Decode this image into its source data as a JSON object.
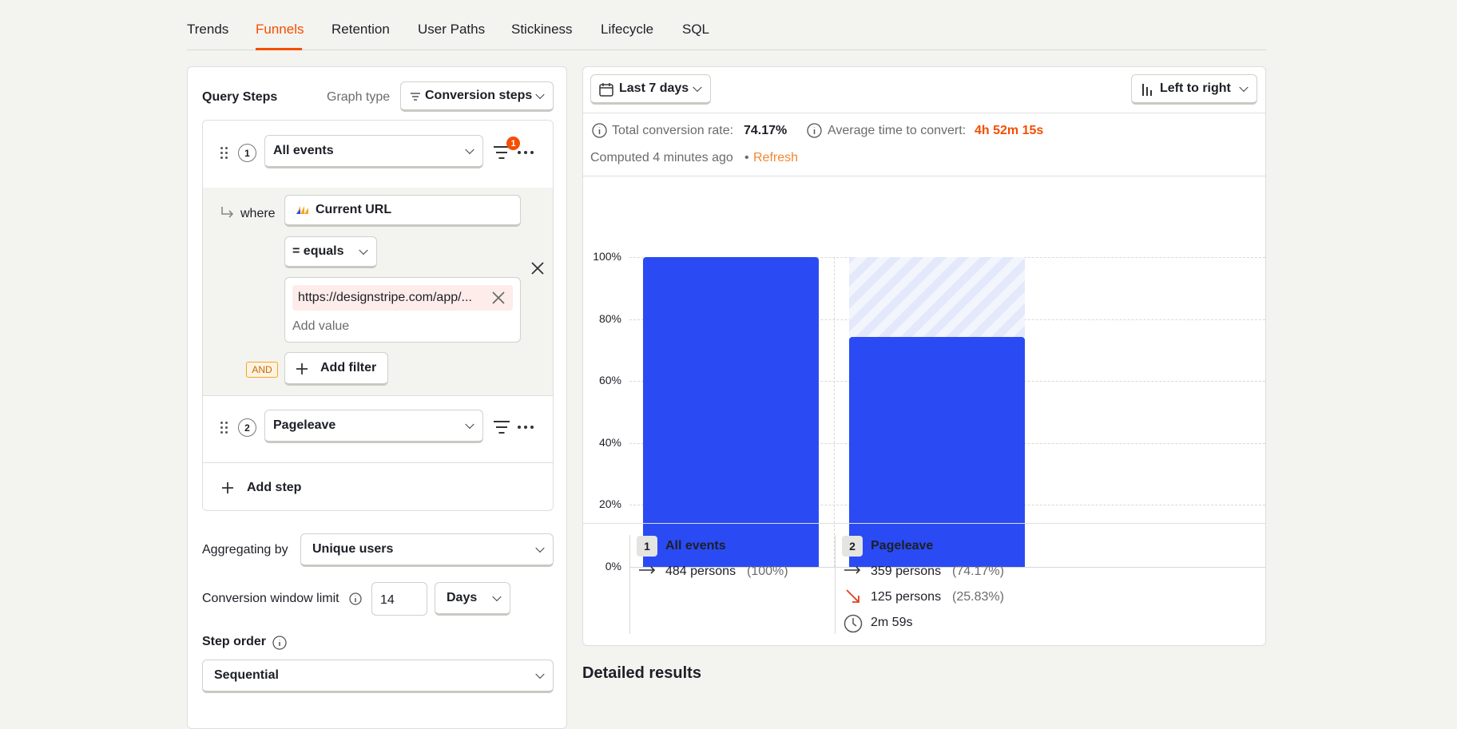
{
  "tabs": [
    "Trends",
    "Funnels",
    "Retention",
    "User Paths",
    "Stickiness",
    "Lifecycle",
    "SQL"
  ],
  "active_tab": "Funnels",
  "query": {
    "title": "Query Steps",
    "graph_type_label": "Graph type",
    "graph_type_value": "Conversion steps",
    "steps": [
      {
        "num": "1",
        "event": "All events",
        "filter_count": "1"
      },
      {
        "num": "2",
        "event": "Pageleave"
      }
    ],
    "filter": {
      "where_label": "where",
      "property": "Current URL",
      "operator": "= equals",
      "value_chip": "https://designstripe.com/app/...",
      "value_placeholder": "Add value",
      "and_label": "AND",
      "add_filter_label": "Add filter"
    },
    "add_step_label": "Add step",
    "aggregating_label": "Aggregating by",
    "aggregating_value": "Unique users",
    "conversion_window_label": "Conversion window limit",
    "conversion_window_value": "14",
    "conversion_window_unit": "Days",
    "step_order_label": "Step order",
    "step_order_value": "Sequential"
  },
  "results": {
    "date_range": "Last 7 days",
    "layout": "Left to right",
    "total_conversion_label": "Total conversion rate:",
    "total_conversion_value": "74.17%",
    "avg_time_label": "Average time to convert:",
    "avg_time_value": "4h 52m 15s",
    "computed_text": "Computed 4 minutes ago",
    "bullet": "•",
    "refresh_label": "Refresh",
    "detailed_title": "Detailed results",
    "legend": [
      {
        "num": "1",
        "name": "All events",
        "persons": "484 persons",
        "pct": "(100%)"
      },
      {
        "num": "2",
        "name": "Pageleave",
        "persons": "359 persons",
        "pct": "(74.17%)",
        "dropped": "125 persons",
        "dropped_pct": "(25.83%)",
        "time": "2m 59s"
      }
    ]
  },
  "chart_data": {
    "type": "bar",
    "categories": [
      "All events",
      "Pageleave"
    ],
    "values": [
      100,
      74.17
    ],
    "ylabel": "",
    "ylim": [
      0,
      100
    ],
    "yticks": [
      "100%",
      "80%",
      "60%",
      "40%",
      "20%",
      "0%"
    ],
    "grid": true
  },
  "colors": {
    "accent": "#f54e00",
    "bar": "#2a4bf3",
    "drop": "#e0401c"
  }
}
